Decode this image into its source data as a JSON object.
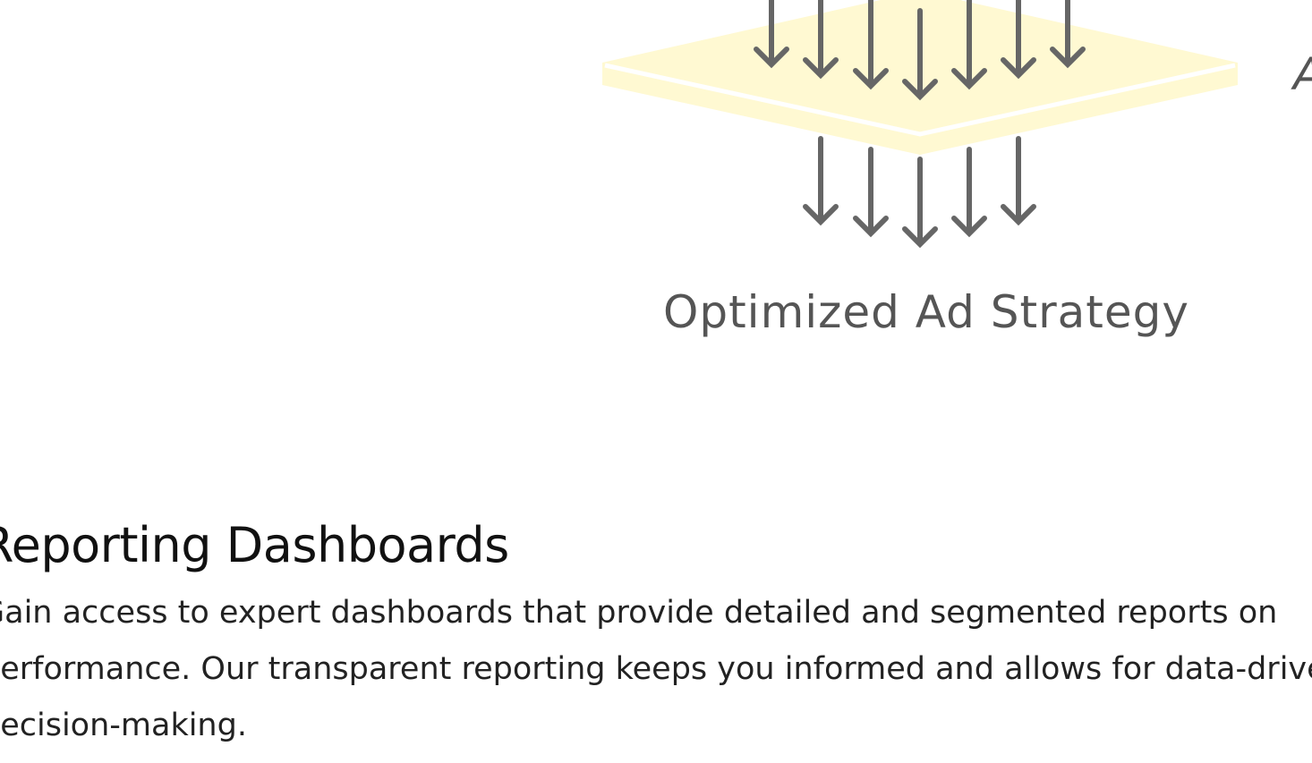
{
  "illustration": {
    "caption": "Optimized Ad Strategy",
    "side_glyph": "A",
    "colors": {
      "layer_fill": "#fff9d2",
      "layer_top": "#e6f5dc",
      "arrow": "#666666",
      "caption": "#555555"
    }
  },
  "section": {
    "title": "Reporting Dashboards",
    "body_lines": [
      "Gain access to expert dashboards that provide detailed and segmented reports on",
      "performance. Our transparent reporting keeps you informed and allows for data-driven",
      "decision-making."
    ]
  }
}
